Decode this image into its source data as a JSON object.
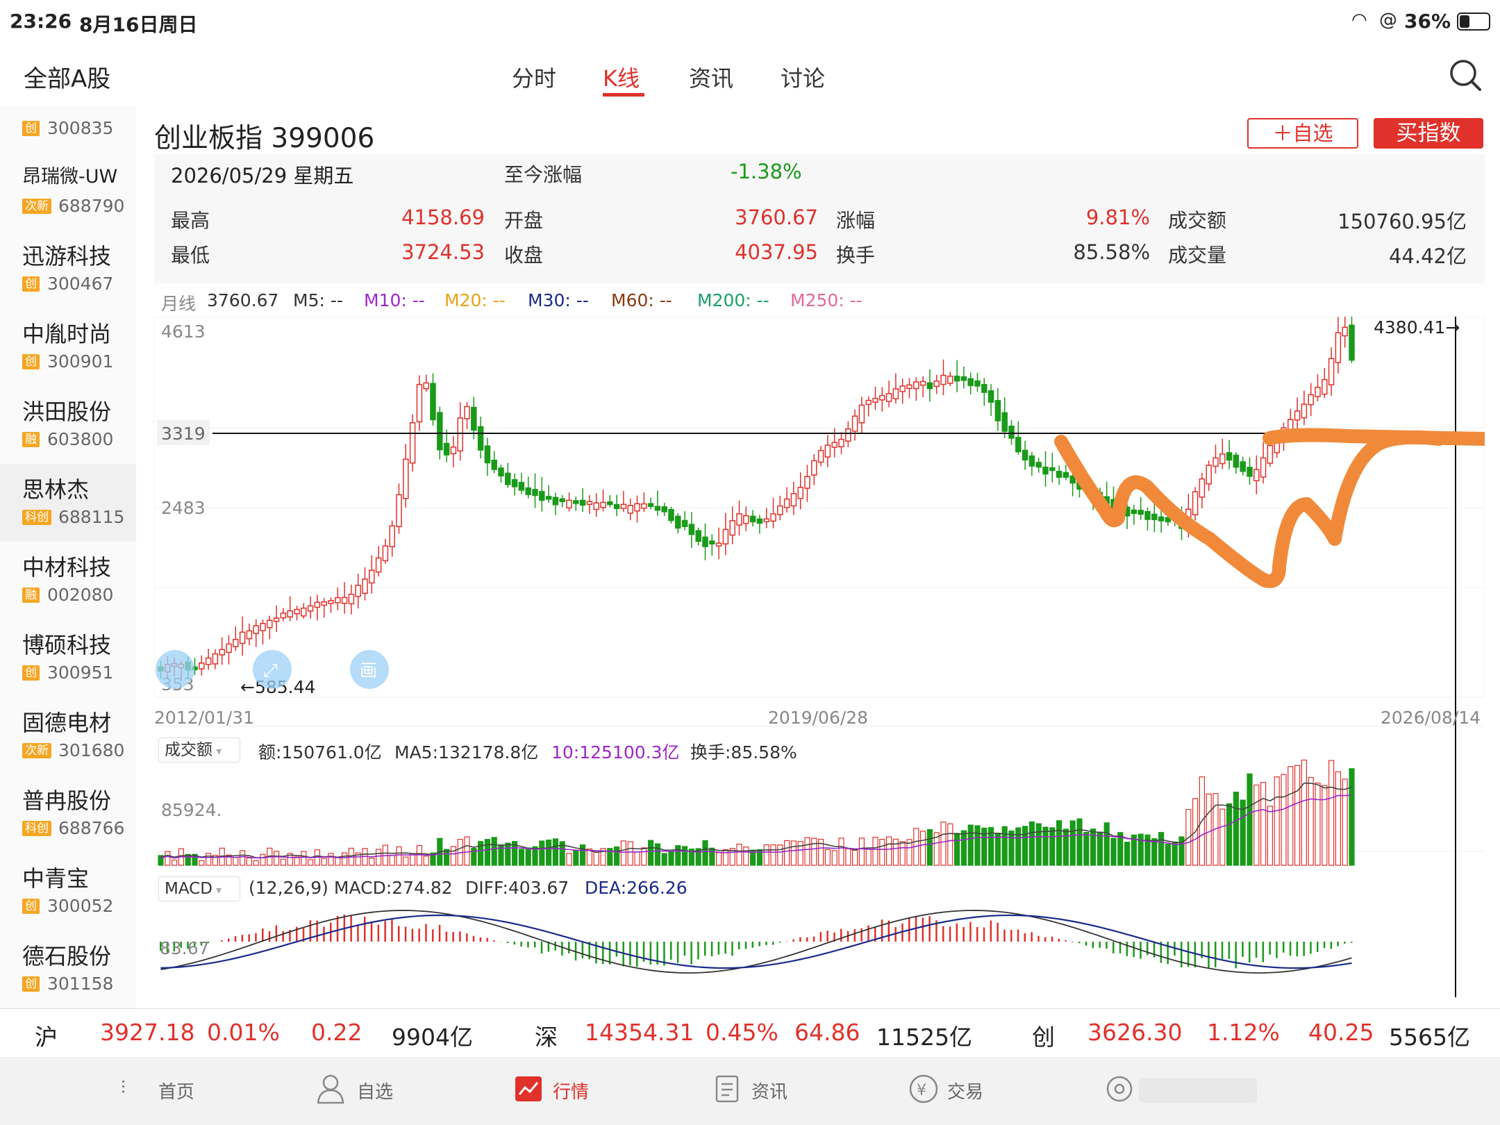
{
  "status": {
    "time": "23:26",
    "date": "8月16日周日",
    "battery": "36%"
  },
  "header": {
    "market_label": "全部A股",
    "tabs": [
      {
        "label": "分时"
      },
      {
        "label": "K线"
      },
      {
        "label": "资讯"
      },
      {
        "label": "讨论"
      }
    ],
    "active_tab": 1,
    "search_icon": "search-icon"
  },
  "sidebar": {
    "items": [
      {
        "name": "",
        "tag": "创",
        "code": "300835"
      },
      {
        "name": "昂瑞微-UW",
        "tag": "次新",
        "code": "688790"
      },
      {
        "name": "迅游科技",
        "tag": "创",
        "code": "300467"
      },
      {
        "name": "中胤时尚",
        "tag": "创",
        "code": "300901"
      },
      {
        "name": "洪田股份",
        "tag": "融",
        "code": "603800"
      },
      {
        "name": "思林杰",
        "tag": "科创",
        "code": "688115"
      },
      {
        "name": "中材科技",
        "tag": "融",
        "code": "002080"
      },
      {
        "name": "博硕科技",
        "tag": "创",
        "code": "300951"
      },
      {
        "name": "固德电材",
        "tag": "次新",
        "code": "301680"
      },
      {
        "name": "普冉股份",
        "tag": "科创",
        "code": "688766"
      },
      {
        "name": "中青宝",
        "tag": "创",
        "code": "300052"
      },
      {
        "name": "德石股份",
        "tag": "创",
        "code": "301158"
      }
    ]
  },
  "stock": {
    "title": "创业板指 399006",
    "add_watch": "＋自选",
    "buy": "买指数",
    "date": "2026/05/29 星期五",
    "change_label": "至今涨幅",
    "change_value": "-1.38%",
    "high_label": "最高",
    "high": "4158.69",
    "open_label": "开盘",
    "open": "3760.67",
    "pct_label": "涨幅",
    "pct": "9.81%",
    "amount_label": "成交额",
    "amount": "150760.95亿",
    "low_label": "最低",
    "low": "3724.53",
    "close_label": "收盘",
    "close": "4037.95",
    "turnover_label": "换手",
    "turnover": "85.58%",
    "volume_label": "成交量",
    "volume": "44.42亿"
  },
  "ma_legend": [
    {
      "text": "月线",
      "color": "#888"
    },
    {
      "text": "3760.67",
      "color": "#333"
    },
    {
      "text": "M5: --",
      "color": "#333"
    },
    {
      "text": "M10: --",
      "color": "#9b27c9"
    },
    {
      "text": "M20: --",
      "color": "#e8a317"
    },
    {
      "text": "M30: --",
      "color": "#1a2a8a"
    },
    {
      "text": "M60: --",
      "color": "#8a3a10"
    },
    {
      "text": "M200: --",
      "color": "#1aa06a"
    },
    {
      "text": "M250: --",
      "color": "#e06a9a"
    }
  ],
  "chart_labels": {
    "y_top": "4613",
    "y_line": "3319",
    "y_mid": "2483",
    "y_low": "353",
    "max_label": "4380.41→",
    "min_label": "←585.44",
    "x_start": "2012/01/31",
    "x_mid": "2019/06/28",
    "x_end": "2026/08/14",
    "draw_icon_text": "画"
  },
  "volume_panel": {
    "selector": "成交额",
    "amount": "额:150761.0亿",
    "ma5": "MA5:132178.8亿",
    "ma10": "10:125100.3亿",
    "turnover": "换手:85.58%",
    "y_label": "85924."
  },
  "macd_panel": {
    "selector": "MACD",
    "params": "(12,26,9) MACD:274.82",
    "diff": "DIFF:403.67",
    "dea": "DEA:266.26",
    "y_label": "83.67"
  },
  "ticker": [
    {
      "market": "沪",
      "price": "3927.18",
      "pct": "0.01%",
      "chg": "0.22",
      "amt": "9904亿"
    },
    {
      "market": "深",
      "price": "14354.31",
      "pct": "0.45%",
      "chg": "64.86",
      "amt": "11525亿"
    },
    {
      "market": "创",
      "price": "3626.30",
      "pct": "1.12%",
      "chg": "40.25",
      "amt": "5565亿"
    }
  ],
  "nav": [
    {
      "label": "首页"
    },
    {
      "label": "自选"
    },
    {
      "label": "行情"
    },
    {
      "label": "资讯"
    },
    {
      "label": "交易"
    },
    {
      "label": ""
    }
  ],
  "nav_active": 2,
  "colors": {
    "up": "#e0312b",
    "down": "#1a9a1a",
    "accent": "#e0312b",
    "annotation": "#f08a3a"
  }
}
